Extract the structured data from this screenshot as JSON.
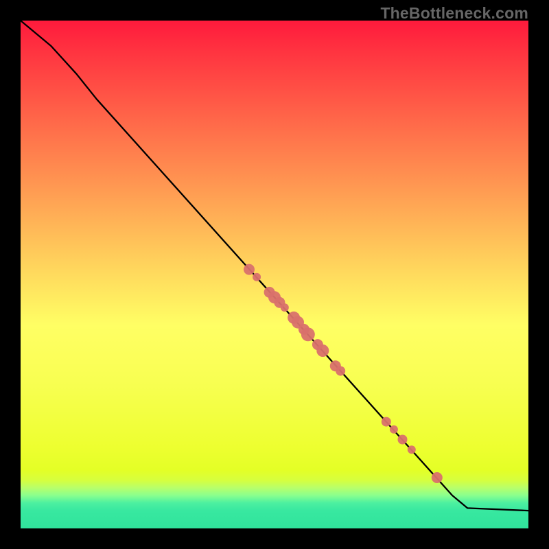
{
  "watermark": "TheBottleneck.com",
  "colors": {
    "point_fill": "#d9716b",
    "curve_stroke": "#000000",
    "frame": "#000000"
  },
  "chart_data": {
    "type": "line",
    "title": "",
    "xlabel": "",
    "ylabel": "",
    "xlim": [
      0,
      100
    ],
    "ylim": [
      0,
      100
    ],
    "grid": false,
    "curve": [
      {
        "x": 0.0,
        "y": 100.0
      },
      {
        "x": 6.0,
        "y": 95.0
      },
      {
        "x": 11.0,
        "y": 89.5
      },
      {
        "x": 15.0,
        "y": 84.5
      },
      {
        "x": 85.0,
        "y": 6.5
      },
      {
        "x": 88.0,
        "y": 4.0
      },
      {
        "x": 100.0,
        "y": 3.5
      }
    ],
    "series": [
      {
        "name": "points",
        "values": [
          {
            "x": 45.0,
            "y": 51.0,
            "r": 8
          },
          {
            "x": 46.5,
            "y": 49.5,
            "r": 6
          },
          {
            "x": 49.0,
            "y": 46.5,
            "r": 8
          },
          {
            "x": 50.0,
            "y": 45.5,
            "r": 9
          },
          {
            "x": 51.0,
            "y": 44.5,
            "r": 8
          },
          {
            "x": 52.0,
            "y": 43.5,
            "r": 6
          },
          {
            "x": 53.8,
            "y": 41.5,
            "r": 9
          },
          {
            "x": 54.6,
            "y": 40.6,
            "r": 9
          },
          {
            "x": 55.8,
            "y": 39.2,
            "r": 8
          },
          {
            "x": 56.6,
            "y": 38.2,
            "r": 10
          },
          {
            "x": 58.5,
            "y": 36.2,
            "r": 8
          },
          {
            "x": 59.5,
            "y": 35.0,
            "r": 9
          },
          {
            "x": 62.0,
            "y": 32.0,
            "r": 8
          },
          {
            "x": 63.0,
            "y": 31.0,
            "r": 7
          },
          {
            "x": 72.0,
            "y": 21.0,
            "r": 7
          },
          {
            "x": 73.5,
            "y": 19.5,
            "r": 6
          },
          {
            "x": 75.2,
            "y": 17.5,
            "r": 7
          },
          {
            "x": 77.0,
            "y": 15.5,
            "r": 6
          },
          {
            "x": 82.0,
            "y": 10.0,
            "r": 8
          }
        ]
      }
    ]
  }
}
